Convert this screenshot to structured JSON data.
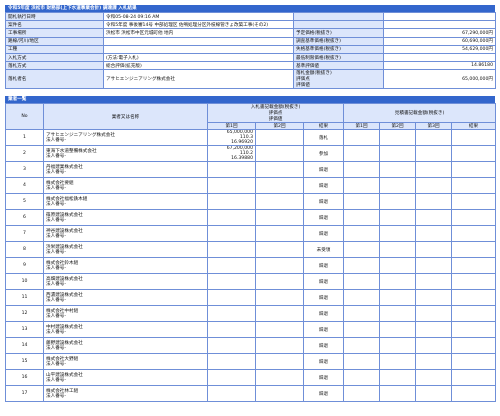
{
  "title": "令和5年度 浜松市 財務部(上下水道事業会計) 調達課 入札結果",
  "info": {
    "left": [
      {
        "label": "開札執行日時",
        "value": "令和05-08-24 09:16 AM"
      },
      {
        "label": "案件名",
        "value": "令和5年度 事後審14号 中部処理区 佐鳴処理分区外枝線管きょ改築工事(その2)"
      },
      {
        "label": "工事場所",
        "value": "浜松市 浜松市中区元城町他 地内"
      },
      {
        "label": "路線/河川/地区",
        "value": ""
      },
      {
        "label": "工種",
        "value": ""
      },
      {
        "label": "入札方式",
        "value": "(方法:電子入札)"
      },
      {
        "label": "落札方式",
        "value": "総合評価(拡充版)"
      },
      {
        "label": "落札者名",
        "value": "アサヒエンジニアリング株式会社"
      }
    ],
    "right": [
      {
        "label": "",
        "value": ""
      },
      {
        "label": "",
        "value": ""
      },
      {
        "label": "予定価格(税抜き)",
        "value": "67,290,000円"
      },
      {
        "label": "調査基準価格(税抜き)",
        "value": "60,690,000円"
      },
      {
        "label": "失格基準価格(税抜き)",
        "value": "54,629,000円"
      },
      {
        "label": "最低制限価格(税抜き)",
        "value": ""
      },
      {
        "label": "基準評価値",
        "value": "14.86180"
      },
      {
        "label": "落札金額(税抜き)\n評価点\n評価値",
        "value": "65,000,000円"
      }
    ]
  },
  "bidders_section": {
    "title": "業者一覧",
    "head": {
      "no": "No",
      "name": "業者又は名称",
      "bid_group": "入札書記載金額(税抜き)\n評価点\n評価値",
      "recheck_group": "見積書記載金額(税抜き)",
      "round1": "第1回",
      "round2": "第2回",
      "round3": "第3回",
      "result": "結果"
    },
    "rows": [
      {
        "no": "1",
        "name": "アサヒエンジニアリング株式会社",
        "sub": "法人番号-",
        "amount": "65,000,000",
        "score": "110.3",
        "value": "16.96920",
        "result": "落札"
      },
      {
        "no": "2",
        "name": "東海下水道整備株式会社",
        "sub": "法人番号-",
        "amount": "67,200,000",
        "score": "110.2",
        "value": "16.39880",
        "result": "参加"
      },
      {
        "no": "3",
        "name": "丹福建業株式会社",
        "sub": "法人番号-",
        "amount": "",
        "score": "",
        "value": "",
        "result": "辞退"
      },
      {
        "no": "4",
        "name": "株式会社要組",
        "sub": "法人番号-",
        "amount": "",
        "score": "",
        "value": "",
        "result": "辞退"
      },
      {
        "no": "5",
        "name": "株式会社福松鉄木組",
        "sub": "法人番号-",
        "amount": "",
        "score": "",
        "value": "",
        "result": "辞退"
      },
      {
        "no": "6",
        "name": "篠原建設株式会社",
        "sub": "法人番号-",
        "amount": "",
        "score": "",
        "value": "",
        "result": "辞退"
      },
      {
        "no": "7",
        "name": "神谷建設株式会社",
        "sub": "法人番号-",
        "amount": "",
        "score": "",
        "value": "",
        "result": "辞退"
      },
      {
        "no": "8",
        "name": "浜栄建設株式会社",
        "sub": "法人番号-",
        "amount": "",
        "score": "",
        "value": "",
        "result": "未受領"
      },
      {
        "no": "9",
        "name": "株式会社鈴木組",
        "sub": "法人番号-",
        "amount": "",
        "score": "",
        "value": "",
        "result": "辞退"
      },
      {
        "no": "10",
        "name": "高畑建設株式会社",
        "sub": "法人番号-",
        "amount": "",
        "score": "",
        "value": "",
        "result": "辞退"
      },
      {
        "no": "11",
        "name": "西濃建設株式会社",
        "sub": "法人番号-",
        "amount": "",
        "score": "",
        "value": "",
        "result": "辞退"
      },
      {
        "no": "12",
        "name": "株式会社中村組",
        "sub": "法人番号-",
        "amount": "",
        "score": "",
        "value": "",
        "result": "辞退"
      },
      {
        "no": "13",
        "name": "中村建設株式会社",
        "sub": "法人番号-",
        "amount": "",
        "score": "",
        "value": "",
        "result": "辞退"
      },
      {
        "no": "14",
        "name": "藤野建設株式会社",
        "sub": "法人番号-",
        "amount": "",
        "score": "",
        "value": "",
        "result": "辞退"
      },
      {
        "no": "15",
        "name": "株式会社大野組",
        "sub": "法人番号-",
        "amount": "",
        "score": "",
        "value": "",
        "result": "辞退"
      },
      {
        "no": "16",
        "name": "山平建設株式会社",
        "sub": "法人番号-",
        "amount": "",
        "score": "",
        "value": "",
        "result": "辞退"
      },
      {
        "no": "17",
        "name": "株式会社林工組",
        "sub": "法人番号-",
        "amount": "",
        "score": "",
        "value": "",
        "result": "辞退"
      }
    ]
  }
}
